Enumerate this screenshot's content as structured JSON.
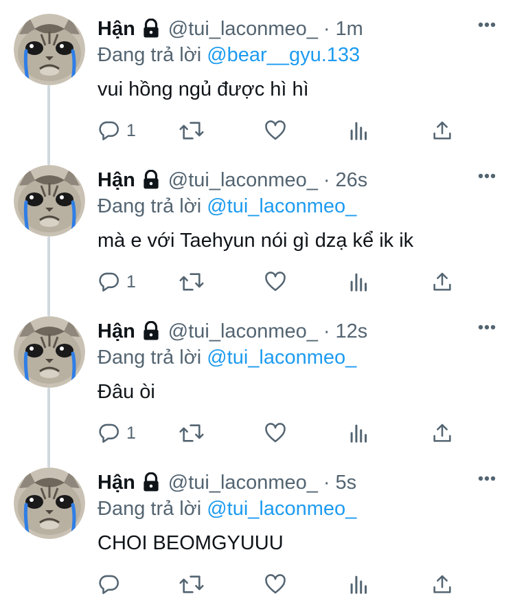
{
  "tweets": [
    {
      "name": "Hận",
      "handle": "@tui_laconmeo_",
      "separator": "·",
      "time": "1m",
      "reply_prefix": "Đang trả lời",
      "reply_to": "@bear__gyu.133",
      "text": "vui hồng ngủ được hì hì",
      "reply_count": "1"
    },
    {
      "name": "Hận",
      "handle": "@tui_laconmeo_",
      "separator": "·",
      "time": "26s",
      "reply_prefix": "Đang trả lời",
      "reply_to": "@tui_laconmeo_",
      "text": "mà e với Taehyun nói gì dzạ kể ik ik",
      "reply_count": "1"
    },
    {
      "name": "Hận",
      "handle": "@tui_laconmeo_",
      "separator": "·",
      "time": "12s",
      "reply_prefix": "Đang trả lời",
      "reply_to": "@tui_laconmeo_",
      "text": "Đâu òi",
      "reply_count": "1"
    },
    {
      "name": "Hận",
      "handle": "@tui_laconmeo_",
      "separator": "·",
      "time": "5s",
      "reply_prefix": "Đang trả lời",
      "reply_to": "@tui_laconmeo_",
      "text": "CHOI BEOMGYUUU",
      "reply_count": ""
    }
  ],
  "icons": {
    "lock": "lock-icon",
    "more": "more-icon",
    "reply": "reply-icon",
    "retweet": "retweet-icon",
    "like": "heart-icon",
    "analytics": "analytics-icon",
    "share": "share-icon"
  },
  "colors": {
    "text": "#0f1419",
    "secondary": "#536471",
    "link": "#1d9bf0",
    "thread_line": "#cfd9de",
    "avatar_tears": "#2f7ee6"
  }
}
